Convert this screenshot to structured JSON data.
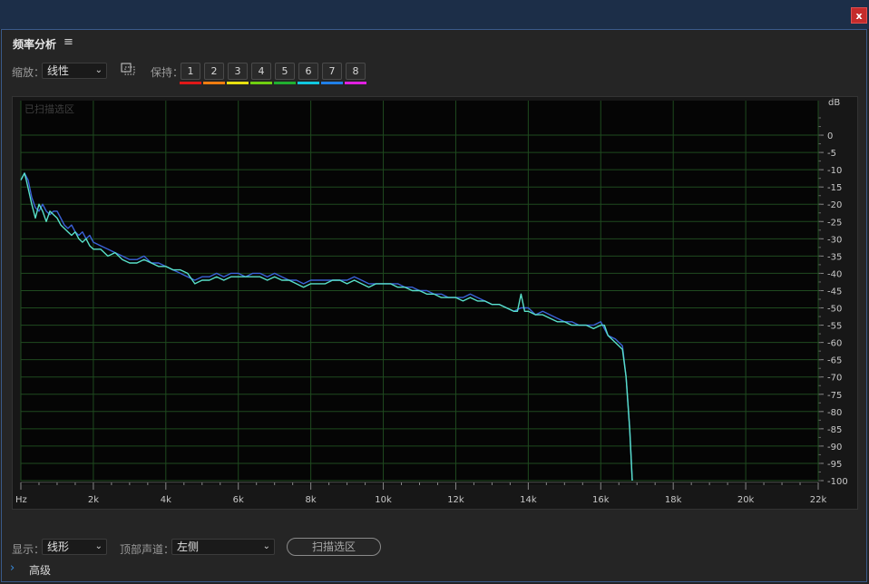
{
  "window": {
    "close_label": "x"
  },
  "panel": {
    "title": "频率分析",
    "menu_icon": "≡"
  },
  "toolbar": {
    "zoom_label": "缩放：",
    "zoom_value": "线性",
    "hold_label": "保持：",
    "hold_buttons": [
      {
        "label": "1",
        "color": "#e01818"
      },
      {
        "label": "2",
        "color": "#f07c10"
      },
      {
        "label": "3",
        "color": "#e8e010"
      },
      {
        "label": "4",
        "color": "#70d010"
      },
      {
        "label": "5",
        "color": "#20b030"
      },
      {
        "label": "6",
        "color": "#10c8e0"
      },
      {
        "label": "7",
        "color": "#2080e8"
      },
      {
        "label": "8",
        "color": "#e020e0"
      }
    ]
  },
  "chart_data": {
    "type": "line",
    "overlay_label": "已扫描选区",
    "x_unit_label": "Hz",
    "y_unit_label": "dB",
    "x_ticks": [
      "2k",
      "4k",
      "6k",
      "8k",
      "10k",
      "12k",
      "14k",
      "16k",
      "18k",
      "20k",
      "22k"
    ],
    "y_ticks": [
      "0",
      "-5",
      "-10",
      "-15",
      "-20",
      "-25",
      "-30",
      "-35",
      "-40",
      "-45",
      "-50",
      "-55",
      "-60",
      "-65",
      "-70",
      "-75",
      "-80",
      "-85",
      "-90",
      "-95",
      "-100"
    ],
    "xlim": [
      0,
      22000
    ],
    "ylim": [
      -100,
      5
    ],
    "grid": true,
    "series": [
      {
        "color": "#3a62d8",
        "points": [
          [
            0,
            -13
          ],
          [
            100,
            -11
          ],
          [
            200,
            -13
          ],
          [
            300,
            -18
          ],
          [
            400,
            -21
          ],
          [
            500,
            -22
          ],
          [
            600,
            -20
          ],
          [
            700,
            -22
          ],
          [
            800,
            -23
          ],
          [
            900,
            -22
          ],
          [
            1000,
            -22
          ],
          [
            1100,
            -24
          ],
          [
            1200,
            -26
          ],
          [
            1300,
            -27
          ],
          [
            1400,
            -26
          ],
          [
            1500,
            -28
          ],
          [
            1600,
            -29
          ],
          [
            1700,
            -28
          ],
          [
            1800,
            -30
          ],
          [
            1900,
            -29
          ],
          [
            2000,
            -31
          ],
          [
            2200,
            -32
          ],
          [
            2400,
            -33
          ],
          [
            2600,
            -34
          ],
          [
            2800,
            -35
          ],
          [
            3000,
            -36
          ],
          [
            3200,
            -36
          ],
          [
            3400,
            -35
          ],
          [
            3600,
            -37
          ],
          [
            3800,
            -37
          ],
          [
            4000,
            -38
          ],
          [
            4200,
            -39
          ],
          [
            4400,
            -40
          ],
          [
            4600,
            -41
          ],
          [
            4800,
            -42
          ],
          [
            5000,
            -41
          ],
          [
            5200,
            -41
          ],
          [
            5400,
            -40
          ],
          [
            5600,
            -41
          ],
          [
            5800,
            -40
          ],
          [
            6000,
            -40
          ],
          [
            6200,
            -41
          ],
          [
            6400,
            -40
          ],
          [
            6600,
            -40
          ],
          [
            6800,
            -41
          ],
          [
            7000,
            -40
          ],
          [
            7200,
            -41
          ],
          [
            7400,
            -42
          ],
          [
            7600,
            -42
          ],
          [
            7800,
            -43
          ],
          [
            8000,
            -42
          ],
          [
            8200,
            -42
          ],
          [
            8400,
            -42
          ],
          [
            8600,
            -42
          ],
          [
            8800,
            -42
          ],
          [
            9000,
            -42
          ],
          [
            9200,
            -41
          ],
          [
            9400,
            -42
          ],
          [
            9600,
            -43
          ],
          [
            9800,
            -43
          ],
          [
            10000,
            -43
          ],
          [
            10200,
            -43
          ],
          [
            10400,
            -43
          ],
          [
            10600,
            -44
          ],
          [
            10800,
            -44
          ],
          [
            11000,
            -45
          ],
          [
            11200,
            -45
          ],
          [
            11400,
            -46
          ],
          [
            11600,
            -46
          ],
          [
            11800,
            -47
          ],
          [
            12000,
            -47
          ],
          [
            12200,
            -47
          ],
          [
            12400,
            -46
          ],
          [
            12600,
            -47
          ],
          [
            12800,
            -48
          ],
          [
            13000,
            -49
          ],
          [
            13200,
            -49
          ],
          [
            13400,
            -50
          ],
          [
            13600,
            -51
          ],
          [
            13800,
            -50
          ],
          [
            14000,
            -50
          ],
          [
            14200,
            -52
          ],
          [
            14400,
            -51
          ],
          [
            14600,
            -52
          ],
          [
            14800,
            -53
          ],
          [
            15000,
            -54
          ],
          [
            15200,
            -54
          ],
          [
            15400,
            -55
          ],
          [
            15600,
            -55
          ],
          [
            15800,
            -55
          ],
          [
            16000,
            -54
          ],
          [
            16200,
            -58
          ],
          [
            16400,
            -59
          ],
          [
            16600,
            -61
          ],
          [
            16700,
            -70
          ],
          [
            16800,
            -85
          ],
          [
            16870,
            -100
          ]
        ]
      },
      {
        "color": "#58e0c8",
        "points": [
          [
            0,
            -13
          ],
          [
            100,
            -11
          ],
          [
            150,
            -13
          ],
          [
            300,
            -20
          ],
          [
            400,
            -24
          ],
          [
            500,
            -20
          ],
          [
            600,
            -22
          ],
          [
            700,
            -25
          ],
          [
            800,
            -22
          ],
          [
            900,
            -23
          ],
          [
            1000,
            -24
          ],
          [
            1100,
            -26
          ],
          [
            1200,
            -27
          ],
          [
            1300,
            -28
          ],
          [
            1400,
            -29
          ],
          [
            1500,
            -28
          ],
          [
            1600,
            -30
          ],
          [
            1700,
            -31
          ],
          [
            1800,
            -30
          ],
          [
            1900,
            -32
          ],
          [
            2000,
            -33
          ],
          [
            2200,
            -33
          ],
          [
            2400,
            -35
          ],
          [
            2600,
            -34
          ],
          [
            2800,
            -36
          ],
          [
            3000,
            -37
          ],
          [
            3200,
            -37
          ],
          [
            3400,
            -36
          ],
          [
            3600,
            -37
          ],
          [
            3800,
            -38
          ],
          [
            4000,
            -38
          ],
          [
            4200,
            -39
          ],
          [
            4400,
            -39
          ],
          [
            4600,
            -40
          ],
          [
            4800,
            -43
          ],
          [
            5000,
            -42
          ],
          [
            5200,
            -42
          ],
          [
            5400,
            -41
          ],
          [
            5600,
            -42
          ],
          [
            5800,
            -41
          ],
          [
            6000,
            -41
          ],
          [
            6200,
            -41
          ],
          [
            6400,
            -41
          ],
          [
            6600,
            -41
          ],
          [
            6800,
            -42
          ],
          [
            7000,
            -41
          ],
          [
            7200,
            -42
          ],
          [
            7400,
            -42
          ],
          [
            7600,
            -43
          ],
          [
            7800,
            -44
          ],
          [
            8000,
            -43
          ],
          [
            8200,
            -43
          ],
          [
            8400,
            -43
          ],
          [
            8600,
            -42
          ],
          [
            8800,
            -42
          ],
          [
            9000,
            -43
          ],
          [
            9200,
            -42
          ],
          [
            9400,
            -43
          ],
          [
            9600,
            -44
          ],
          [
            9800,
            -43
          ],
          [
            10000,
            -43
          ],
          [
            10200,
            -43
          ],
          [
            10400,
            -44
          ],
          [
            10600,
            -44
          ],
          [
            10800,
            -45
          ],
          [
            11000,
            -45
          ],
          [
            11200,
            -46
          ],
          [
            11400,
            -46
          ],
          [
            11600,
            -47
          ],
          [
            11800,
            -47
          ],
          [
            12000,
            -47
          ],
          [
            12200,
            -48
          ],
          [
            12400,
            -47
          ],
          [
            12600,
            -48
          ],
          [
            12800,
            -48
          ],
          [
            13000,
            -49
          ],
          [
            13200,
            -49
          ],
          [
            13400,
            -50
          ],
          [
            13600,
            -51
          ],
          [
            13700,
            -51
          ],
          [
            13800,
            -46
          ],
          [
            13900,
            -51
          ],
          [
            14000,
            -51
          ],
          [
            14200,
            -52
          ],
          [
            14400,
            -52
          ],
          [
            14600,
            -53
          ],
          [
            14800,
            -54
          ],
          [
            15000,
            -54
          ],
          [
            15200,
            -55
          ],
          [
            15400,
            -55
          ],
          [
            15600,
            -55
          ],
          [
            15800,
            -56
          ],
          [
            16000,
            -55
          ],
          [
            16100,
            -55
          ],
          [
            16200,
            -58
          ],
          [
            16400,
            -60
          ],
          [
            16600,
            -62
          ],
          [
            16700,
            -70
          ],
          [
            16800,
            -85
          ],
          [
            16870,
            -100
          ]
        ]
      }
    ]
  },
  "bottom": {
    "display_label": "显示：",
    "display_value": "线形",
    "channel_label": "顶部声道：",
    "channel_value": "左侧",
    "scan_button": "扫描选区",
    "advanced_label": "高级"
  }
}
